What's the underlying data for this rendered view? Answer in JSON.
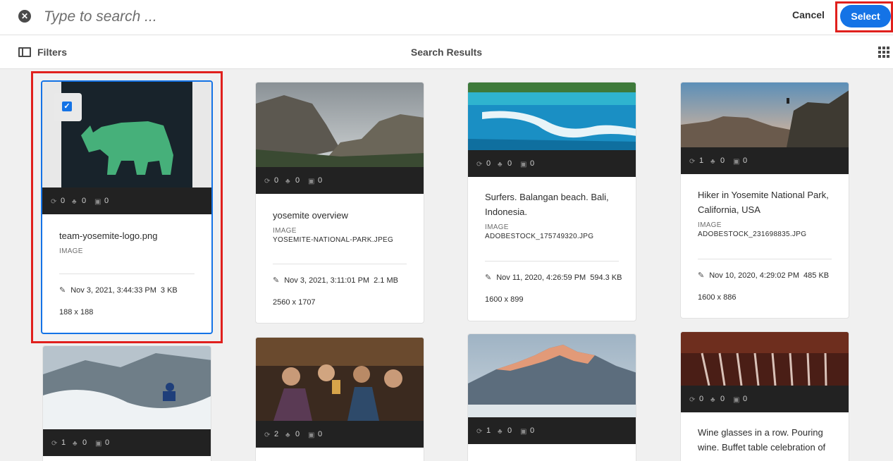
{
  "search": {
    "placeholder": "Type to search ..."
  },
  "header": {
    "cancel_label": "Cancel",
    "select_label": "Select"
  },
  "toolbar": {
    "filters_label": "Filters",
    "title": "Search Results"
  },
  "cards": [
    {
      "title": "team-yosemite-logo.png",
      "type": "IMAGE",
      "filename": "",
      "date": "Nov 3, 2021, 3:44:33 PM",
      "size": "3 KB",
      "dims": "188 x 188",
      "stats": [
        "0",
        "0",
        "0"
      ],
      "selected": true
    },
    {
      "title": "yosemite overview",
      "type": "IMAGE",
      "filename": "YOSEMITE-NATIONAL-PARK.JPEG",
      "date": "Nov 3, 2021, 3:11:01 PM",
      "size": "2.1 MB",
      "dims": "2560 x 1707",
      "stats": [
        "0",
        "0",
        "0"
      ]
    },
    {
      "title": "Surfers. Balangan beach. Bali, Indonesia.",
      "type": "IMAGE",
      "filename": "ADOBESTOCK_175749320.JPG",
      "date": "Nov 11, 2020, 4:26:59 PM",
      "size": "594.3 KB",
      "dims": "1600 x 899",
      "stats": [
        "0",
        "0",
        "0"
      ]
    },
    {
      "title": "Hiker in Yosemite National Park, California, USA",
      "type": "IMAGE",
      "filename": "ADOBESTOCK_231698835.JPG",
      "date": "Nov 10, 2020, 4:29:02 PM",
      "size": "485 KB",
      "dims": "1600 x 886",
      "stats": [
        "1",
        "0",
        "0"
      ]
    },
    {
      "title": "",
      "stats": [
        "1",
        "0",
        "0"
      ]
    },
    {
      "title": "",
      "stats": [
        "2",
        "0",
        "0"
      ]
    },
    {
      "title": "",
      "stats": [
        "1",
        "0",
        "0"
      ]
    },
    {
      "title": "Wine glasses in a row. Pouring wine. Buffet table celebration of",
      "stats": [
        "0",
        "0",
        "0"
      ]
    }
  ],
  "colors": {
    "accent": "#1473e6",
    "highlight": "#e0201d",
    "logo_bg": "#18232b",
    "logo_rhino": "#46b07a"
  },
  "icons": [
    "close-icon",
    "filters-icon",
    "grid-view-icon",
    "checkbox-icon",
    "sync-icon",
    "users-icon",
    "comment-icon",
    "pencil-icon"
  ]
}
